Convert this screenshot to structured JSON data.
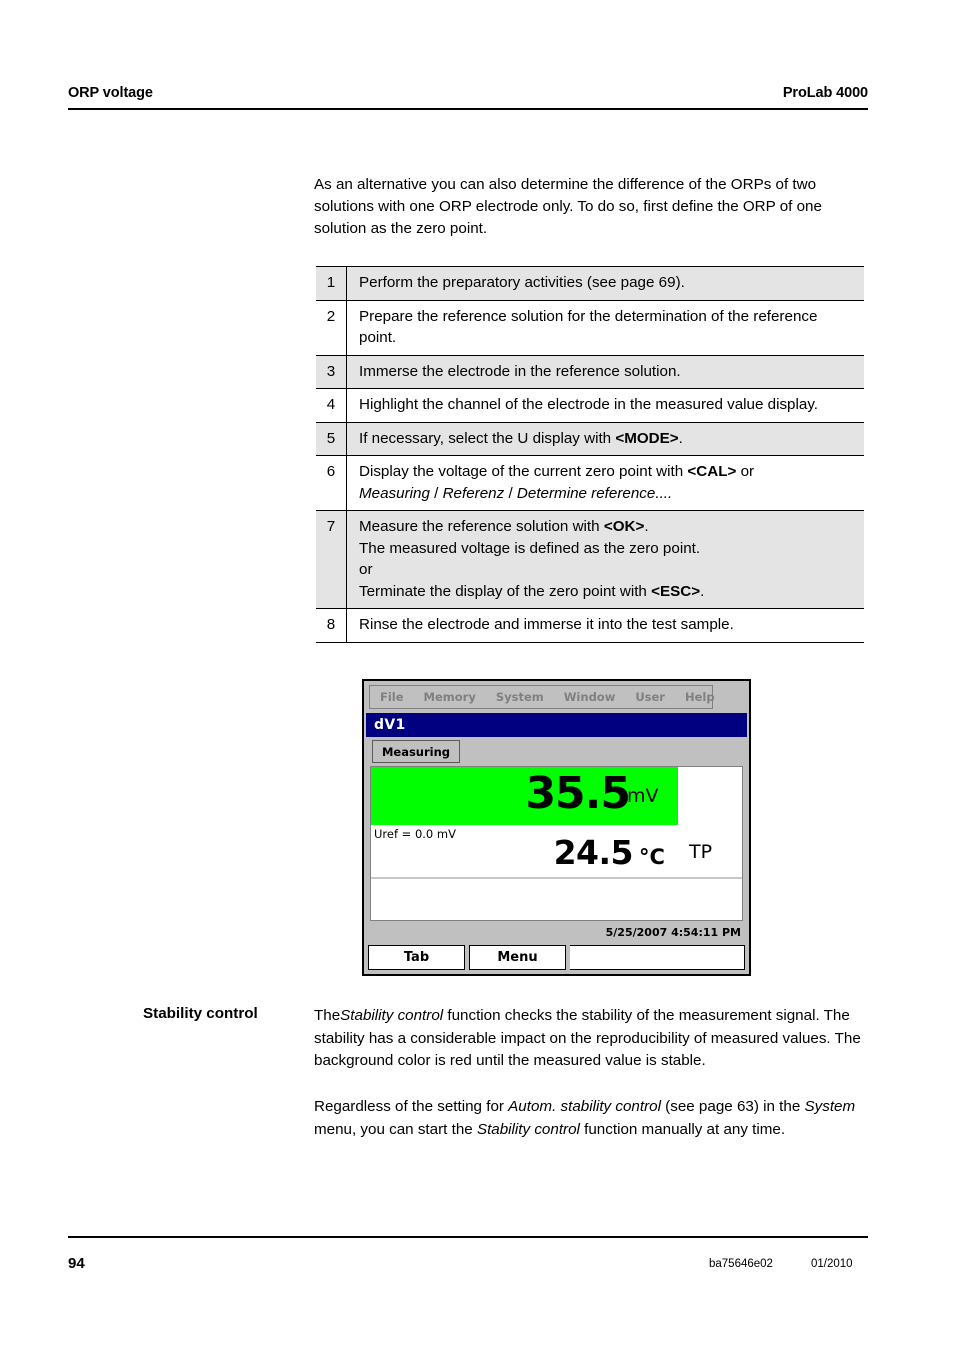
{
  "header": {
    "left_title": "ORP voltage",
    "right_title": "ProLab 4000"
  },
  "intro": {
    "text": "As an alternative you can also determine the difference of the ORPs of two solutions with one ORP electrode only. To do so, first define the ORP of one solution as the zero point."
  },
  "steps": [
    {
      "num": "1",
      "text": "Perform the preparatory activities (see page 69)."
    },
    {
      "num": "2",
      "text": "Prepare the reference solution for the determination of the reference point."
    },
    {
      "num": "3",
      "text": "Immerse the electrode in the reference solution."
    },
    {
      "num": "4",
      "text": "Highlight the channel of the electrode in the measured value display."
    },
    {
      "num": "5",
      "text": "If necessary, select the U display with <MODE>."
    },
    {
      "num": "6",
      "text": "Display the voltage of the current zero point with <CAL> or Measuring / Referenz / Determine reference...."
    },
    {
      "num": "7",
      "text": "Measure the reference solution with <OK>. The measured voltage is defined as the zero point. or Terminate the display of the zero point with <ESC>."
    },
    {
      "num": "8",
      "text": "Rinse the electrode and immerse it into the test sample."
    }
  ],
  "step_parts": {
    "s5": {
      "a": "If necessary, select the U display with ",
      "b": "<MODE>",
      "c": "."
    },
    "s6": {
      "a": "Display the voltage of the current zero point with ",
      "b": "<CAL>",
      "c": " or",
      "d": "Measuring",
      "e": " / ",
      "f": "Referenz",
      "g": " / ",
      "h": "Determine reference...."
    },
    "s7": {
      "a": "Measure the reference solution with ",
      "b": "<OK>",
      "c": ".",
      "d": "The measured voltage is defined as the zero point.",
      "e": "or",
      "f": "Terminate the display of the zero point with ",
      "g": "<ESC>",
      "h": "."
    }
  },
  "device": {
    "menu_items": [
      "File",
      "Memory",
      "System",
      "Window",
      "User",
      "Help"
    ],
    "window_title": "dV1",
    "tab_label": "Measuring",
    "measured_value": "35.5",
    "measured_unit": "mV",
    "reference": "Uref = 0.0 mV",
    "temperature": "24.5",
    "temperature_unit": "°C",
    "temp_flag": "TP",
    "timestamp": "5/25/2007 4:54:11 PM",
    "softkey_left": "Tab",
    "softkey_right": "Menu",
    "colors": {
      "measurement_background": "#00ff00",
      "titlebar": "#000080",
      "chrome": "#c0c0c0"
    }
  },
  "stability": {
    "label": "Stability control",
    "p1_a": "The",
    "p1_b": "Stability control",
    "p1_c": " function checks the stability of the measurement signal. The stability has a considerable impact on the reproducibility of measured values. The background color is red until the measured value is stable.",
    "p2_a": "Regardless of the setting for ",
    "p2_b": "Autom. stability control",
    "p2_c": " (see page 63) in the ",
    "p2_d": "System",
    "p2_e": " menu, you can start the ",
    "p2_f": "Stability control",
    "p2_g": " function manually at any time."
  },
  "footer": {
    "page_number": "94",
    "doc_number": "ba75646e02",
    "date": "01/2010"
  }
}
